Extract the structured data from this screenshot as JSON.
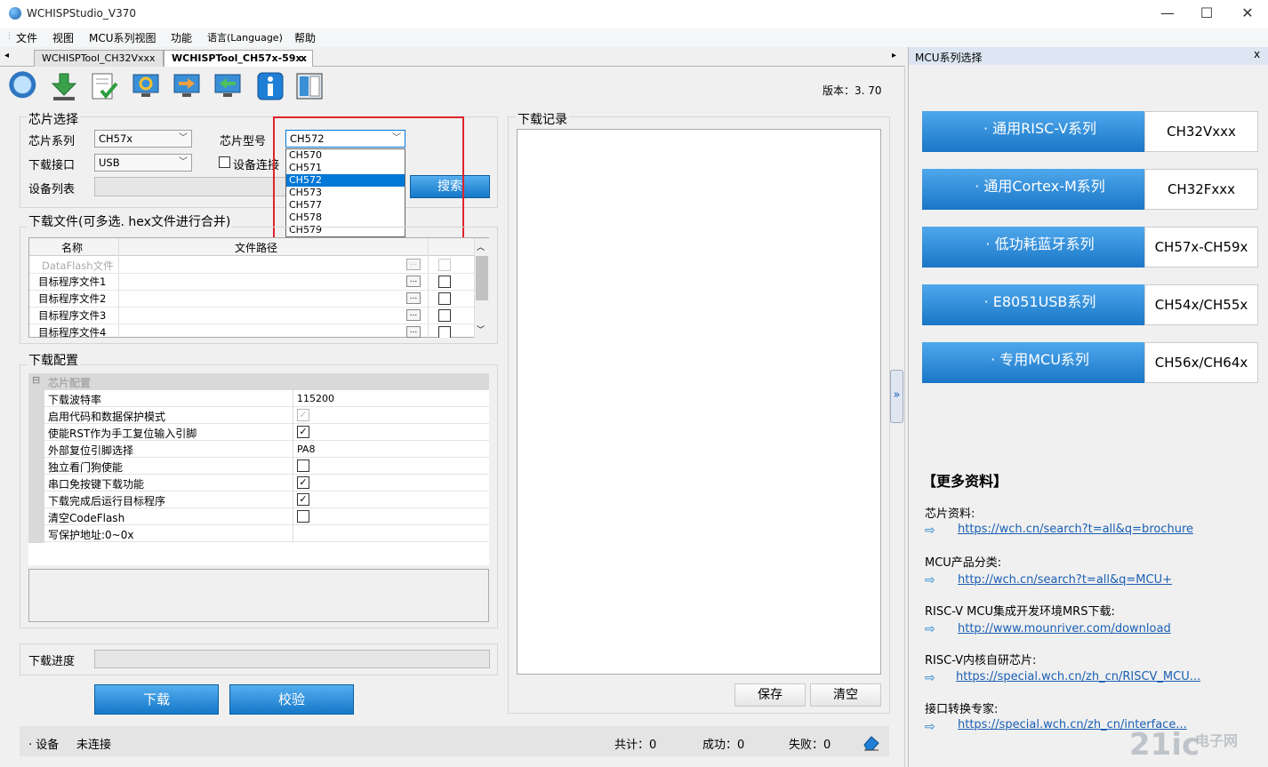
{
  "window": {
    "title": "WCHISPStudio_V370",
    "minimize": "—",
    "maximize": "☐",
    "close": "✕"
  },
  "menu": [
    "文件",
    "视图",
    "MCU系列视图",
    "功能",
    "语言(Language)",
    "帮助"
  ],
  "tabs": [
    {
      "label": "WCHISPTool_CH32Vxxx"
    },
    {
      "label": "WCHISPTool_CH57x-59x",
      "close": "x"
    }
  ],
  "version": "版本：3. 70",
  "chip_select": {
    "legend": "芯片选择",
    "series_label": "芯片系列",
    "series_value": "CH57x",
    "model_label": "芯片型号",
    "model_value": "CH572",
    "interface_label": "下载接口",
    "interface_value": "USB",
    "device_connect_label": "设备连接",
    "device_list_label": "设备列表",
    "search_button": "搜索",
    "dropdown_options": [
      "CH570",
      "CH571",
      "CH572",
      "CH573",
      "CH577",
      "CH578",
      "CH579"
    ],
    "dropdown_selected": "CH572"
  },
  "download_files": {
    "legend": "下载文件(可多选. hex文件进行合并)",
    "col_name": "名称",
    "col_path": "文件路径",
    "rows": [
      {
        "name": "DataFlash文件",
        "browse": "...",
        "disabled": true
      },
      {
        "name": "目标程序文件1",
        "browse": "..."
      },
      {
        "name": "目标程序文件2",
        "browse": "..."
      },
      {
        "name": "目标程序文件3",
        "browse": "..."
      },
      {
        "name": "目标程序文件4",
        "browse": "..."
      }
    ]
  },
  "download_config": {
    "legend": "下载配置",
    "section": "芯片配置",
    "expander": "⊟",
    "rows": [
      {
        "name": "下载波特率",
        "value": "115200"
      },
      {
        "name": "启用代码和数据保护模式",
        "check": "✓",
        "disabled": true
      },
      {
        "name": "使能RST作为手工复位输入引脚",
        "check": "✓"
      },
      {
        "name": "外部复位引脚选择",
        "value": "PA8"
      },
      {
        "name": "独立看门狗使能",
        "check": ""
      },
      {
        "name": "串口免按键下载功能",
        "check": "✓"
      },
      {
        "name": "下载完成后运行目标程序",
        "check": "✓"
      },
      {
        "name": "清空CodeFlash",
        "check": ""
      },
      {
        "name": "写保护地址:0~0x",
        "value": ""
      }
    ]
  },
  "progress": {
    "label": "下载进度"
  },
  "actions": {
    "download": "下载",
    "verify": "校验"
  },
  "log": {
    "legend": "下载记录",
    "save": "保存",
    "clear": "清空"
  },
  "status": {
    "device_label": "· 设备",
    "device_state": "未连接",
    "total": "共计：0",
    "success": "成功：0",
    "fail": "失败：0"
  },
  "mcu_panel": {
    "title": "MCU系列选择",
    "close": "x",
    "collapse": "»",
    "series": [
      {
        "name": "· 通用RISC-V系列",
        "chips": "CH32Vxxx"
      },
      {
        "name": "· 通用Cortex-M系列",
        "chips": "CH32Fxxx"
      },
      {
        "name": "· 低功耗蓝牙系列",
        "chips": "CH57x-CH59x"
      },
      {
        "name": "· E8051USB系列",
        "chips": "CH54x/CH55x"
      },
      {
        "name": "· 专用MCU系列",
        "chips": "CH56x/CH64x"
      }
    ],
    "more_title": "【更多资料】",
    "resources": [
      {
        "label": "芯片资料:",
        "link": "https://wch.cn/search?t=all&q=brochure"
      },
      {
        "label": "MCU产品分类:",
        "link": "http://wch.cn/search?t=all&q=MCU+"
      },
      {
        "label": "RISC-V MCU集成开发环境MRS下载:",
        "link": "http://www.mounriver.com/download"
      },
      {
        "label": "RISC-V内核自研芯片:",
        "link": "https://special.wch.cn/zh_cn/RISCV_MCU..."
      },
      {
        "label": "接口转换专家:",
        "link": "https://special.wch.cn/zh_cn/interface..."
      }
    ],
    "arrow_glyph": "⇨"
  },
  "watermark": {
    "main": "21ic",
    "sub": "电子网"
  },
  "colors": {
    "accent": "#1a76c7",
    "highlight_box": "#e0232a",
    "selected": "#0078d7"
  }
}
